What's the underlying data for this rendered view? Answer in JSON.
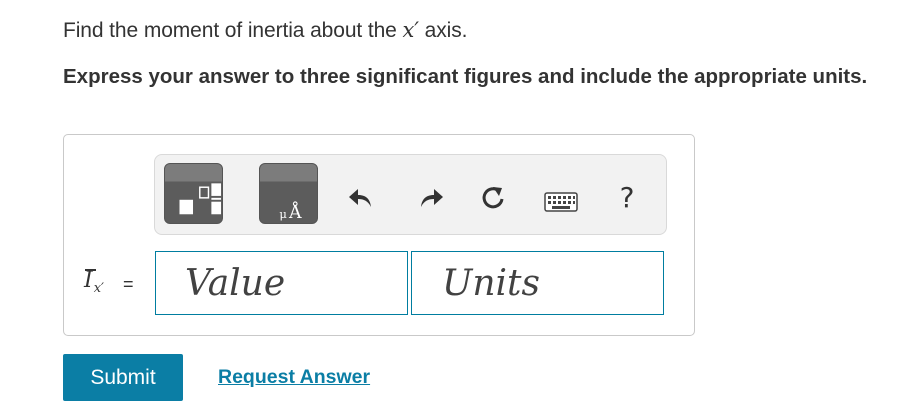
{
  "question": {
    "prefix": "Find the moment of inertia about the ",
    "symbol": "x′",
    "suffix": " axis."
  },
  "instruction": "Express your answer to three significant figures and include the appropriate units.",
  "toolbar": {
    "buttons": [
      {
        "icon": "templates-icon"
      },
      {
        "icon": "units-angstrom-icon",
        "glyph": "Å",
        "sub_glyph": "μ"
      },
      {
        "icon": "undo-icon"
      },
      {
        "icon": "redo-icon"
      },
      {
        "icon": "reset-icon"
      },
      {
        "icon": "keyboard-icon"
      },
      {
        "icon": "help-icon",
        "glyph": "?"
      }
    ]
  },
  "answer": {
    "variable": "I",
    "subscript": "x′",
    "equals": "=",
    "value_placeholder": "Value",
    "units_placeholder": "Units"
  },
  "actions": {
    "submit_label": "Submit",
    "request_label": "Request Answer"
  },
  "colors": {
    "accent": "#0b7ea5",
    "text": "#333333",
    "field_border": "#007da0"
  }
}
